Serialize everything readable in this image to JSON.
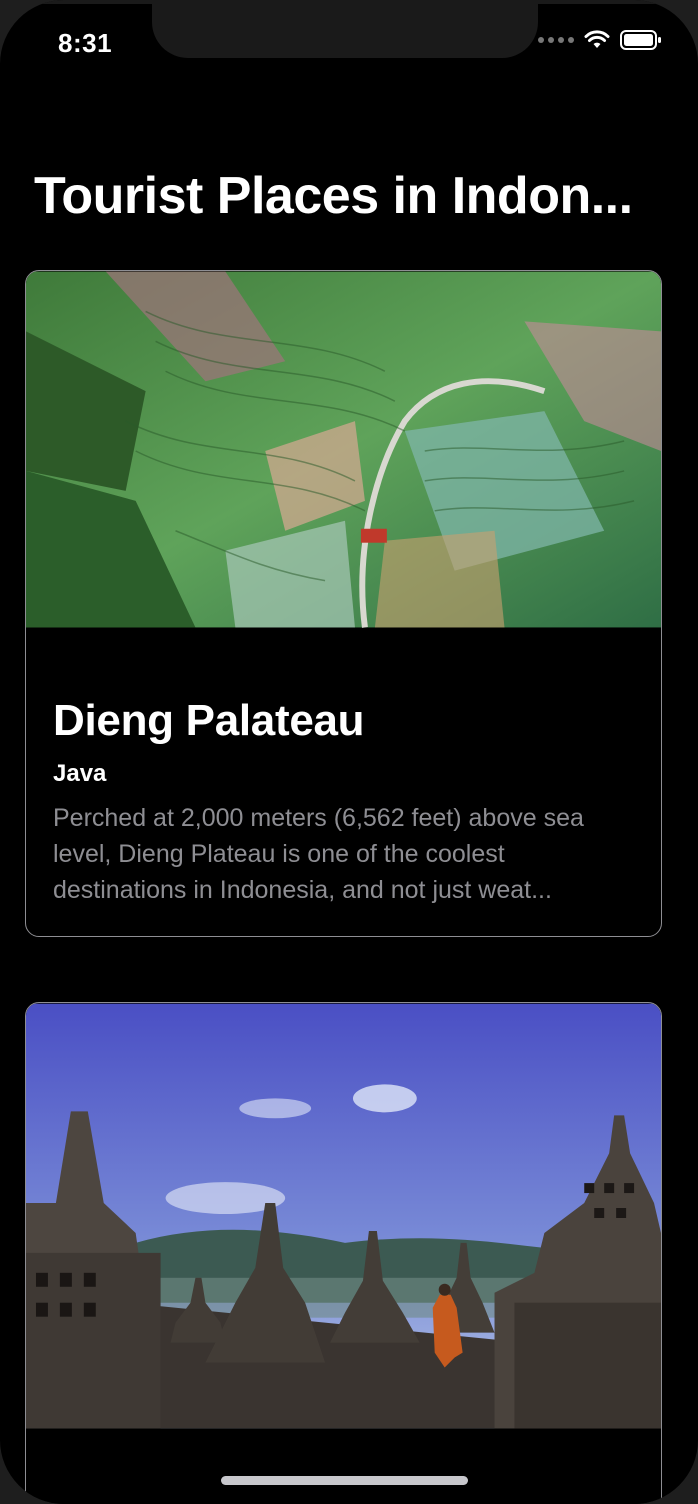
{
  "status_bar": {
    "time": "8:31"
  },
  "page": {
    "title": "Tourist Places in Indon..."
  },
  "places": [
    {
      "name": "Dieng Palateau",
      "region": "Java",
      "description": "Perched at 2,000 meters (6,562 feet) above sea level, Dieng Plateau is one of the coolest destinations in Indonesia, and not just weat..."
    }
  ],
  "colors": {
    "background": "#000000",
    "card_border": "#8e8e93",
    "secondary_text": "#8e8e93"
  }
}
